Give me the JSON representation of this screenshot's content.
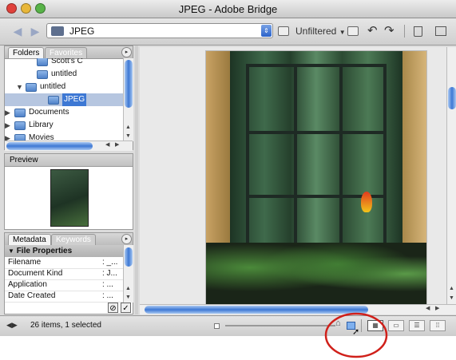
{
  "window": {
    "title": "JPEG - Adobe Bridge"
  },
  "toolbar": {
    "back_icon": "back-arrow-icon",
    "forward_icon": "forward-arrow-icon",
    "path_label": "JPEG",
    "filter_label": "Unfiltered",
    "filter_arrow": "▼"
  },
  "folders_panel": {
    "tabs": [
      "Folders",
      "Favorites"
    ],
    "tree": [
      {
        "label": "Scott's C",
        "indent": 2,
        "expanded": null,
        "selected": false
      },
      {
        "label": "untitled",
        "indent": 2,
        "expanded": null,
        "selected": false
      },
      {
        "label": "untitled",
        "indent": 1,
        "expanded": true,
        "selected": false
      },
      {
        "label": "JPEG",
        "indent": 3,
        "expanded": null,
        "selected": true
      },
      {
        "label": "Documents",
        "indent": 0,
        "expanded": false,
        "selected": false
      },
      {
        "label": "Library",
        "indent": 0,
        "expanded": false,
        "selected": false
      },
      {
        "label": "Movies",
        "indent": 0,
        "expanded": false,
        "selected": false
      }
    ]
  },
  "preview_panel": {
    "title": "Preview"
  },
  "metadata_panel": {
    "tabs": [
      "Metadata",
      "Keywords"
    ],
    "section_title": "File Properties",
    "rows": [
      {
        "key": "Filename",
        "value": ": _..."
      },
      {
        "key": "Document Kind",
        "value": ": J..."
      },
      {
        "key": "Application",
        "value": ": ..."
      },
      {
        "key": "Date Created",
        "value": ": ..."
      }
    ]
  },
  "status": {
    "text": "26 items, 1 selected"
  },
  "colors": {
    "selection": "#b6c6e0",
    "accent": "#3d78d4",
    "annotation": "#d0201a"
  }
}
